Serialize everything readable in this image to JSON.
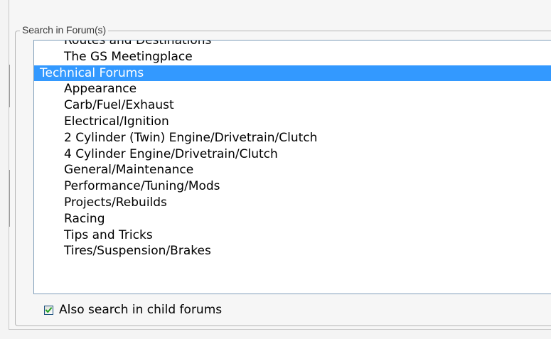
{
  "fieldset": {
    "legend": "Search in Forum(s)"
  },
  "listbox": {
    "items": [
      {
        "label": "Routes and Destinations",
        "level": "child"
      },
      {
        "label": "The GS Meetingplace",
        "level": "child"
      },
      {
        "label": "Technical Forums",
        "level": "group",
        "selected": true
      },
      {
        "label": "Appearance",
        "level": "child"
      },
      {
        "label": "Carb/Fuel/Exhaust",
        "level": "child"
      },
      {
        "label": "Electrical/Ignition",
        "level": "child"
      },
      {
        "label": "2 Cylinder (Twin) Engine/Drivetrain/Clutch",
        "level": "child"
      },
      {
        "label": "4 Cylinder Engine/Drivetrain/Clutch",
        "level": "child"
      },
      {
        "label": "General/Maintenance",
        "level": "child"
      },
      {
        "label": "Performance/Tuning/Mods",
        "level": "child"
      },
      {
        "label": "Projects/Rebuilds",
        "level": "child"
      },
      {
        "label": "Racing",
        "level": "child"
      },
      {
        "label": "Tips and Tricks",
        "level": "child"
      },
      {
        "label": "Tires/Suspension/Brakes",
        "level": "child"
      }
    ],
    "selected_color": "#3399ff"
  },
  "child_forums": {
    "checked": true,
    "label": "Also search in child forums"
  }
}
